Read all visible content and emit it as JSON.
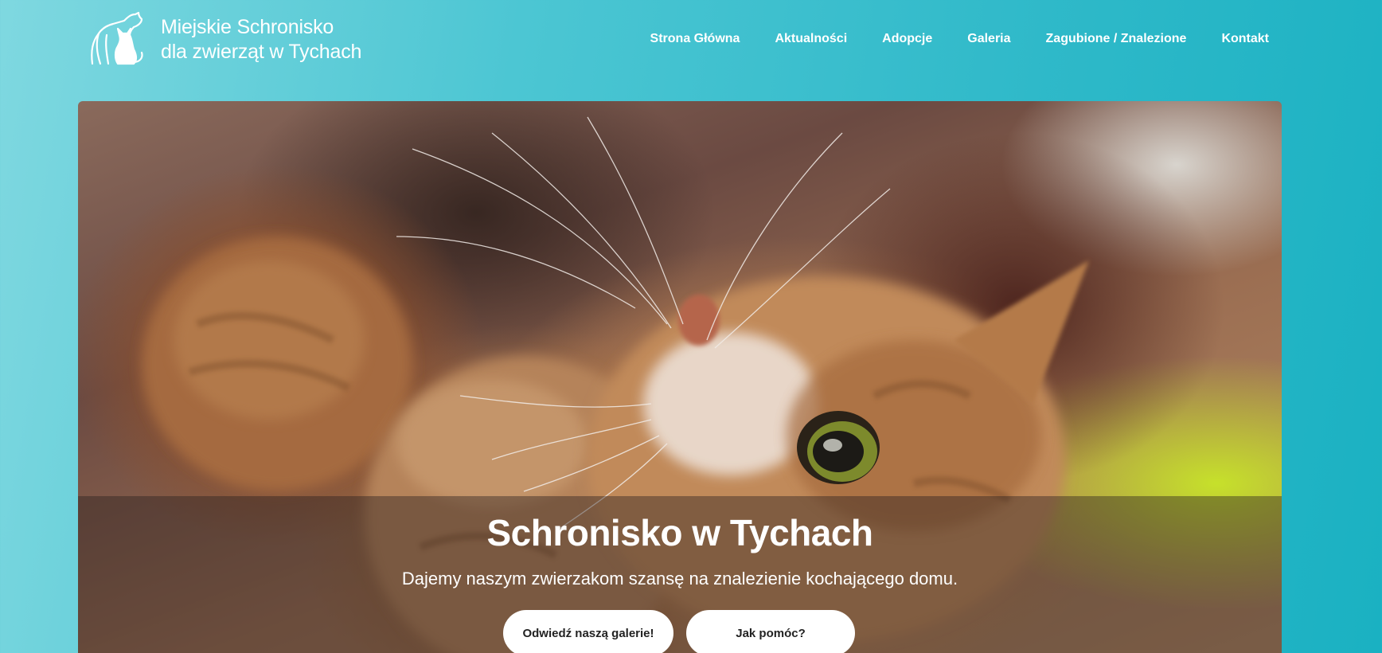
{
  "logo": {
    "line1": "Miejskie Schronisko",
    "line2": "dla zwierząt w Tychach",
    "icon": "dog-and-cat-icon"
  },
  "nav": {
    "items": [
      {
        "label": "Strona Główna"
      },
      {
        "label": "Aktualności"
      },
      {
        "label": "Adopcje"
      },
      {
        "label": "Galeria"
      },
      {
        "label": "Zagubione / Znalezione"
      },
      {
        "label": "Kontakt"
      }
    ]
  },
  "hero": {
    "title": "Schronisko w Tychach",
    "subtitle": "Dajemy naszym zwierzakom szansę na znalezienie kochającego domu.",
    "buttons": {
      "gallery": "Odwiedź naszą galerie!",
      "help": "Jak pomóc?"
    }
  },
  "colors": {
    "background_start": "#7fd8e0",
    "background_end": "#1ab1c2",
    "text": "#ffffff",
    "button_bg": "#ffffff",
    "button_text": "#222222"
  }
}
